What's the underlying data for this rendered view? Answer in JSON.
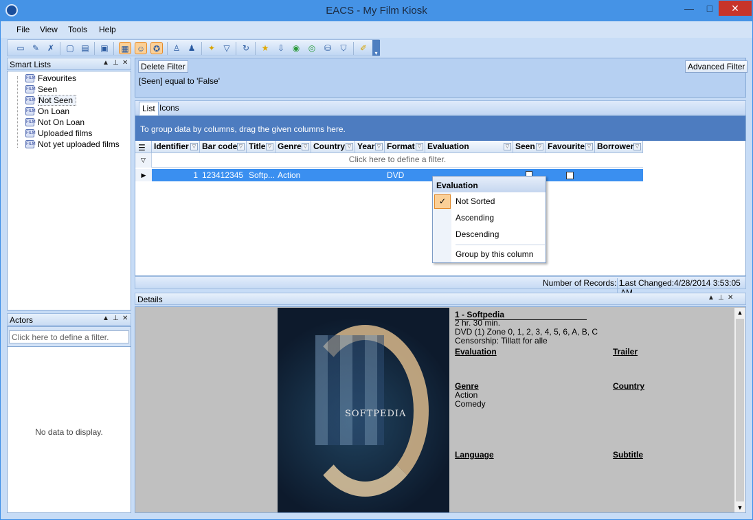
{
  "window": {
    "title": "EACS - My Film Kiosk",
    "minimize": "—",
    "maximize": "□",
    "close": "✕"
  },
  "menu": [
    "File",
    "View",
    "Tools",
    "Help"
  ],
  "smart_lists": {
    "title": "Smart Lists",
    "items": [
      "Favourites",
      "Seen",
      "Not Seen",
      "On Loan",
      "Not On Loan",
      "Uploaded films",
      "Not yet uploaded films"
    ]
  },
  "actors": {
    "title": "Actors",
    "filter_placeholder": "Click here to define a filter.",
    "empty": "No data to display."
  },
  "filter": {
    "delete_label": "Delete Filter",
    "advanced_label": "Advanced Filter",
    "expression": "[Seen] equal to 'False'"
  },
  "tabs": [
    "List",
    "Icons"
  ],
  "group_hint": "To group data by columns, drag the given columns here.",
  "columns": [
    "Identifier",
    "Bar code",
    "Title",
    "Genre",
    "Country",
    "Year",
    "Format",
    "Evaluation",
    "Seen",
    "Favourite",
    "Borrower"
  ],
  "filter_row": "Click here to define a filter.",
  "row": {
    "identifier": "1",
    "barcode": "123412345",
    "title": "Softp...",
    "genre": "Action",
    "format": "DVD"
  },
  "status": {
    "records": "Number of Records: 1",
    "changed": "Last Changed:4/28/2014 3:53:05 AM"
  },
  "context_menu": {
    "header": "Evaluation",
    "items": [
      "Not Sorted",
      "Ascending",
      "Descending",
      "Group by this column"
    ],
    "checked": "✓"
  },
  "details": {
    "title": "Details",
    "film_title": "1 - Softpedia",
    "duration": "2 hr. 30 min.",
    "disc": "DVD (1) Zone 0, 1, 2, 3, 4, 5, 6, A, B, C",
    "censorship": "Censorship: Tillatt for alle",
    "evaluation_label": "Evaluation",
    "trailer_label": "Trailer",
    "genre_label": "Genre",
    "genres": [
      "Action",
      "Comedy"
    ],
    "country_label": "Country",
    "language_label": "Language",
    "subtitle_label": "Subtitle",
    "poster_text": "SOFTPEDIA"
  }
}
